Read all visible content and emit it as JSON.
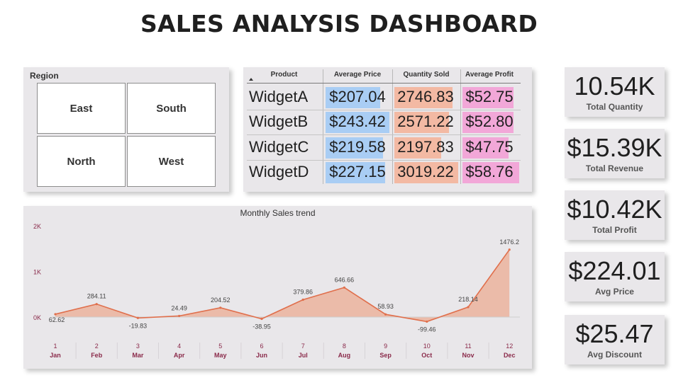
{
  "title": "SALES ANALYSIS DASHBOARD",
  "region_slicer": {
    "title": "Region",
    "options": [
      "East",
      "South",
      "North",
      "West"
    ]
  },
  "product_table": {
    "headers": [
      "Product",
      "Average Price",
      "Quantity Sold",
      "Average Profit"
    ],
    "rows": [
      {
        "product": "WidgetA",
        "avg_price": "$207.04",
        "qty_sold": "2746.83",
        "avg_profit": "$52.75",
        "price_num": 207.04,
        "qty_num": 2746.83,
        "profit_num": 52.75
      },
      {
        "product": "WidgetB",
        "avg_price": "$243.42",
        "qty_sold": "2571.22",
        "avg_profit": "$52.80",
        "price_num": 243.42,
        "qty_num": 2571.22,
        "profit_num": 52.8
      },
      {
        "product": "WidgetC",
        "avg_price": "$219.58",
        "qty_sold": "2197.83",
        "avg_profit": "$47.75",
        "price_num": 219.58,
        "qty_num": 2197.83,
        "profit_num": 47.75
      },
      {
        "product": "WidgetD",
        "avg_price": "$227.15",
        "qty_sold": "3019.22",
        "avg_profit": "$58.76",
        "price_num": 227.15,
        "qty_num": 3019.22,
        "profit_num": 58.76
      }
    ],
    "bar_colors": {
      "price": "#a9cdf4",
      "qty": "#f3b9a3",
      "profit": "#f2a7d8"
    }
  },
  "chart_data": {
    "type": "area",
    "title": "Monthly Sales trend",
    "x_numbers": [
      "1",
      "2",
      "3",
      "4",
      "5",
      "6",
      "7",
      "8",
      "9",
      "10",
      "11",
      "12"
    ],
    "categories": [
      "Jan",
      "Feb",
      "Mar",
      "Apr",
      "May",
      "Jun",
      "Jul",
      "Aug",
      "Sep",
      "Oct",
      "Nov",
      "Dec"
    ],
    "values": [
      62.62,
      284.11,
      -19.83,
      24.49,
      204.52,
      -38.95,
      379.86,
      646.66,
      58.93,
      -99.46,
      218.14,
      1476.2
    ],
    "labels": [
      "62.62",
      "284.11",
      "-19.83",
      "24.49",
      "204.52",
      "-38.95",
      "379.86",
      "646.66",
      "58.93",
      "-99.46",
      "218.14",
      "1476.2"
    ],
    "y_ticks": [
      "0K",
      "1K",
      "2K"
    ],
    "ylim": [
      0,
      2000
    ],
    "line_color": "#e06f4c",
    "fill_color": "#ebb39d",
    "axis_label_color": "#8a2a4a"
  },
  "kpis": [
    {
      "value": "10.54K",
      "label": "Total Quantity"
    },
    {
      "value": "$15.39K",
      "label": "Total Revenue"
    },
    {
      "value": "$10.42K",
      "label": "Total Profit"
    },
    {
      "value": "$224.01",
      "label": "Avg Price"
    },
    {
      "value": "$25.47",
      "label": "Avg Discount"
    }
  ]
}
